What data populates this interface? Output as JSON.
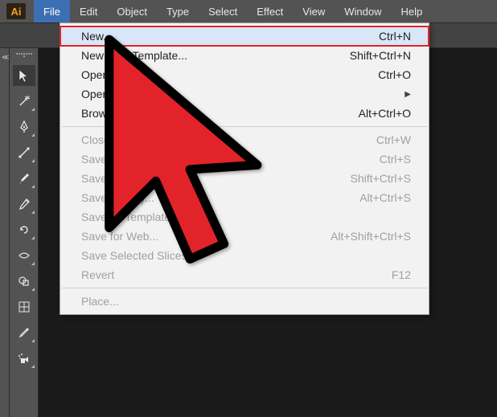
{
  "app": {
    "logo_text": "Ai"
  },
  "menubar": {
    "items": [
      "File",
      "Edit",
      "Object",
      "Type",
      "Select",
      "Effect",
      "View",
      "Window",
      "Help"
    ],
    "active_index": 0
  },
  "file_menu": {
    "groups": [
      [
        {
          "label": "New...",
          "shortcut": "Ctrl+N",
          "highlighted": true,
          "emphasized": true
        },
        {
          "label": "New from Template...",
          "shortcut": "Shift+Ctrl+N"
        },
        {
          "label": "Open...",
          "shortcut": "Ctrl+O"
        },
        {
          "label": "Open Recent Files",
          "submenu": true
        },
        {
          "label": "Browse in Bridge...",
          "shortcut": "Alt+Ctrl+O"
        }
      ],
      [
        {
          "label": "Close",
          "shortcut": "Ctrl+W",
          "disabled": true
        },
        {
          "label": "Save",
          "shortcut": "Ctrl+S",
          "disabled": true
        },
        {
          "label": "Save As...",
          "shortcut": "Shift+Ctrl+S",
          "disabled": true
        },
        {
          "label": "Save a Copy...",
          "shortcut": "Alt+Ctrl+S",
          "disabled": true
        },
        {
          "label": "Save as Template...",
          "disabled": true
        },
        {
          "label": "Save for Web...",
          "shortcut": "Alt+Shift+Ctrl+S",
          "disabled": true
        },
        {
          "label": "Save Selected Slices...",
          "disabled": true
        },
        {
          "label": "Revert",
          "shortcut": "F12",
          "disabled": true
        }
      ],
      [
        {
          "label": "Place...",
          "disabled": true
        }
      ]
    ]
  },
  "tools": [
    {
      "name": "selection-tool",
      "sub": false
    },
    {
      "name": "magic-wand-tool",
      "sub": true
    },
    {
      "name": "pen-tool",
      "sub": true
    },
    {
      "name": "line-segment-tool",
      "sub": true
    },
    {
      "name": "paintbrush-tool",
      "sub": true
    },
    {
      "name": "pencil-tool",
      "sub": true
    },
    {
      "name": "rotate-tool",
      "sub": true
    },
    {
      "name": "width-tool",
      "sub": true
    },
    {
      "name": "shape-builder-tool",
      "sub": true
    },
    {
      "name": "mesh-tool",
      "sub": false
    },
    {
      "name": "eyedropper-tool",
      "sub": true
    },
    {
      "name": "symbol-sprayer-tool",
      "sub": true
    }
  ],
  "annotation": {
    "cursor_color": "#e3232a",
    "cursor_outline": "#000000"
  }
}
